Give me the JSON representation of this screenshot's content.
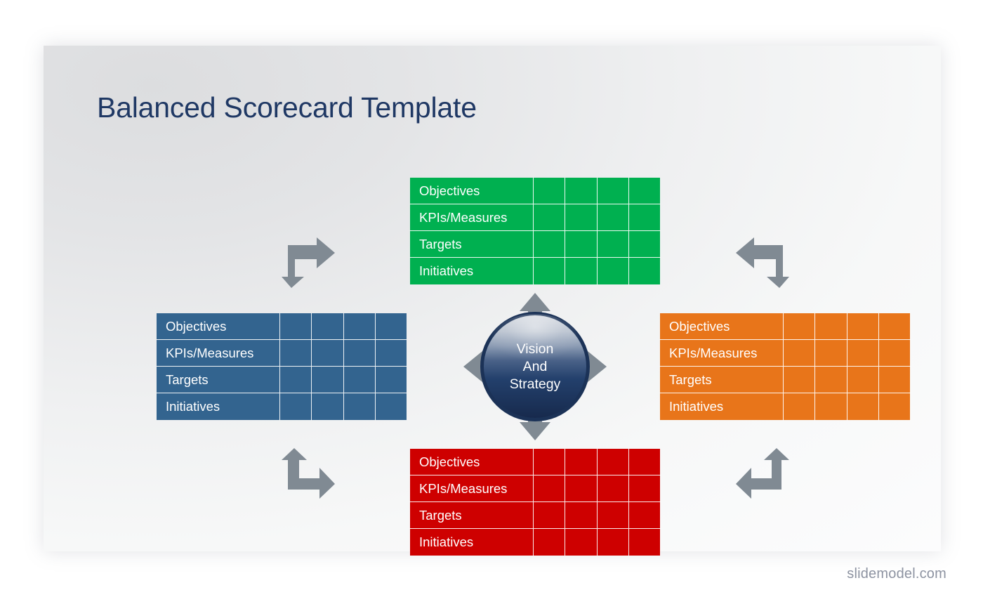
{
  "slide": {
    "title": "Balanced Scorecard Template",
    "title_color": "#1f3864",
    "background_color": "#eff0f1",
    "watermark": "slidemodel.com"
  },
  "center": {
    "name": "vision-and-strategy-hub",
    "line1": "Vision",
    "line2": "And",
    "line3": "Strategy",
    "sphere_color": "#1F3864",
    "arrow_color": "#808A93",
    "arrows": [
      "arrow-up",
      "arrow-down",
      "arrow-left",
      "arrow-right"
    ]
  },
  "row_labels": [
    "Objectives",
    "KPIs/Measures",
    "Targets",
    "Initiatives"
  ],
  "blank_columns": 4,
  "scorecards": [
    {
      "id": "top",
      "position": "top",
      "color": "#00B050",
      "color_name": "green",
      "rows": [
        {
          "label": "Objectives",
          "cells": [
            "",
            "",
            "",
            ""
          ]
        },
        {
          "label": "KPIs/Measures",
          "cells": [
            "",
            "",
            "",
            ""
          ]
        },
        {
          "label": "Targets",
          "cells": [
            "",
            "",
            "",
            ""
          ]
        },
        {
          "label": "Initiatives",
          "cells": [
            "",
            "",
            "",
            ""
          ]
        }
      ]
    },
    {
      "id": "left",
      "position": "left",
      "color": "#33648F",
      "color_name": "blue",
      "rows": [
        {
          "label": "Objectives",
          "cells": [
            "",
            "",
            "",
            ""
          ]
        },
        {
          "label": "KPIs/Measures",
          "cells": [
            "",
            "",
            "",
            ""
          ]
        },
        {
          "label": "Targets",
          "cells": [
            "",
            "",
            "",
            ""
          ]
        },
        {
          "label": "Initiatives",
          "cells": [
            "",
            "",
            "",
            ""
          ]
        }
      ]
    },
    {
      "id": "right",
      "position": "right",
      "color": "#E8751A",
      "color_name": "orange",
      "rows": [
        {
          "label": "Objectives",
          "cells": [
            "",
            "",
            "",
            ""
          ]
        },
        {
          "label": "KPIs/Measures",
          "cells": [
            "",
            "",
            "",
            ""
          ]
        },
        {
          "label": "Targets",
          "cells": [
            "",
            "",
            "",
            ""
          ]
        },
        {
          "label": "Initiatives",
          "cells": [
            "",
            "",
            "",
            ""
          ]
        }
      ]
    },
    {
      "id": "bottom",
      "position": "bottom",
      "color": "#CE0000",
      "color_name": "red",
      "rows": [
        {
          "label": "Objectives",
          "cells": [
            "",
            "",
            "",
            ""
          ]
        },
        {
          "label": "KPIs/Measures",
          "cells": [
            "",
            "",
            "",
            ""
          ]
        },
        {
          "label": "Targets",
          "cells": [
            "",
            "",
            "",
            ""
          ]
        },
        {
          "label": "Initiatives",
          "cells": [
            "",
            "",
            "",
            ""
          ]
        }
      ]
    }
  ],
  "corner_arrows": [
    {
      "id": "top-left",
      "name": "elbow-arrow-right-down",
      "color": "#808A93"
    },
    {
      "id": "top-right",
      "name": "elbow-arrow-left-down",
      "color": "#808A93"
    },
    {
      "id": "bottom-left",
      "name": "elbow-arrow-up-right",
      "color": "#808A93"
    },
    {
      "id": "bottom-right",
      "name": "elbow-arrow-up-left",
      "color": "#808A93"
    }
  ]
}
